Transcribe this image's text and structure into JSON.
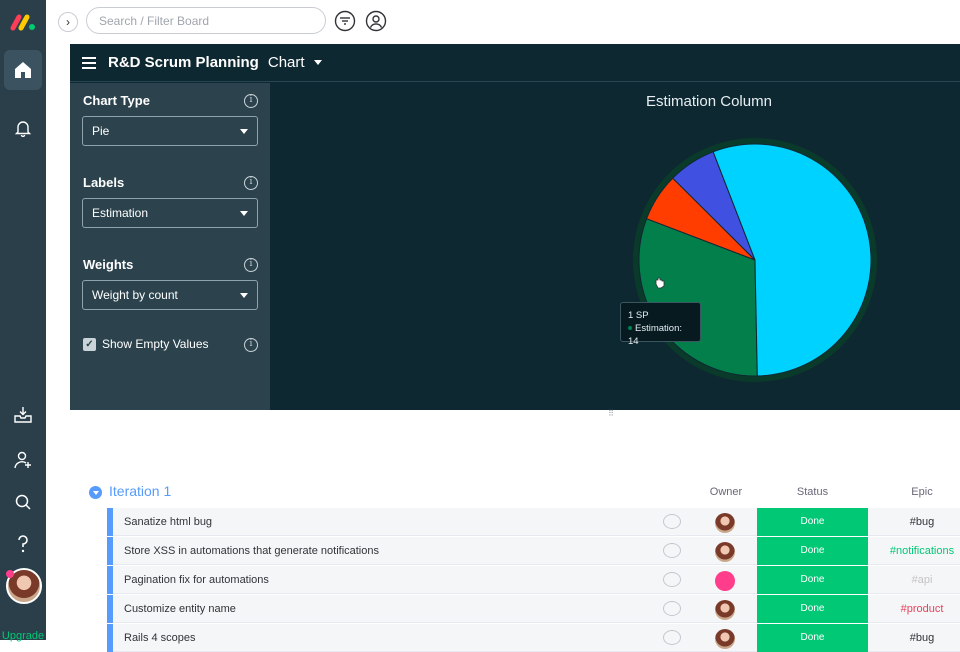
{
  "rail": {
    "upgrade_label": "Upgrade"
  },
  "topbar": {
    "search_placeholder": "Search / Filter Board",
    "collapse_glyph": "›"
  },
  "board_header": {
    "title": "R&D Scrum Planning",
    "view": "Chart"
  },
  "settings": {
    "chart_type_label": "Chart Type",
    "chart_type_value": "Pie",
    "labels_label": "Labels",
    "labels_value": "Estimation",
    "weights_label": "Weights",
    "weights_value": "Weight by count",
    "show_empty_label": "Show Empty Values",
    "show_empty_checked": true
  },
  "tooltip": {
    "label": "1 SP",
    "series_line": "Estimation: 14"
  },
  "chart_data": {
    "type": "pie",
    "title": "Estimation Column",
    "slices": [
      {
        "label": "1 SP",
        "value": 14,
        "color": "#037f4c"
      },
      {
        "label": "",
        "value": 3,
        "color": "#ff3d00"
      },
      {
        "label": "",
        "value": 3,
        "color": "#4050e0"
      },
      {
        "label": "",
        "value": 25,
        "color": "#00d2ff"
      }
    ]
  },
  "group": {
    "title": "Iteration 1",
    "color": "#579bfc",
    "columns": [
      "Owner",
      "Status",
      "Epic"
    ]
  },
  "rows": [
    {
      "name": "Sanatize html bug",
      "status": "Done",
      "epic": "#bug",
      "epic_color": "#323338"
    },
    {
      "name": "Store XSS in automations that generate notifications",
      "status": "Done",
      "epic": "#notifications",
      "epic_color": "#00c875"
    },
    {
      "name": "Pagination fix for automations",
      "status": "Done",
      "epic": "#api",
      "epic_color": "#c4c4c4"
    },
    {
      "name": "Customize entity name",
      "status": "Done",
      "epic": "#product",
      "epic_color": "#e2445c"
    },
    {
      "name": "Rails 4 scopes",
      "status": "Done",
      "epic": "#bug",
      "epic_color": "#323338"
    }
  ]
}
